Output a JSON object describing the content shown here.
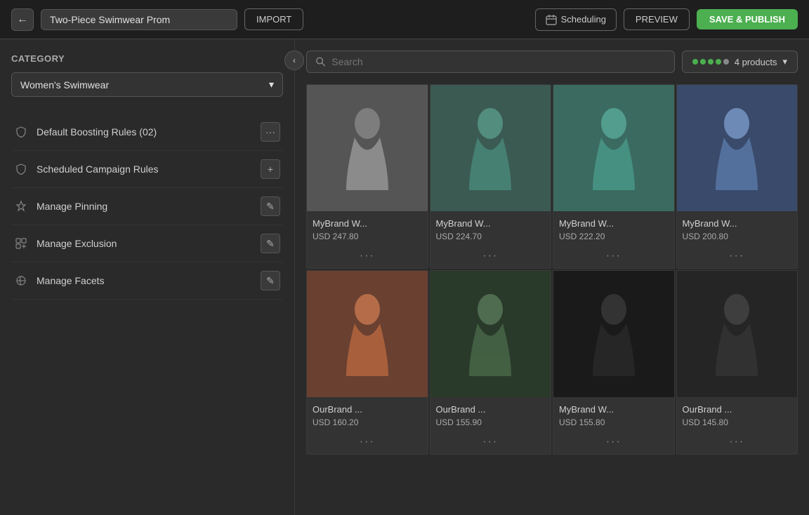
{
  "header": {
    "back_label": "←",
    "page_title": "Two-Piece Swimwear Prom",
    "import_label": "IMPORT",
    "scheduling_label": "Scheduling",
    "preview_label": "PREVIEW",
    "save_publish_label": "SAVE & PUBLISH"
  },
  "sidebar": {
    "category_label": "Category",
    "category_value": "Women's Swimwear",
    "collapse_icon": "‹",
    "menu_items": [
      {
        "id": "boosting",
        "label": "Default Boosting Rules (02)",
        "action": "···",
        "icon_type": "shield"
      },
      {
        "id": "campaign",
        "label": "Scheduled Campaign Rules",
        "action": "+",
        "icon_type": "shield"
      },
      {
        "id": "pinning",
        "label": "Manage Pinning",
        "action": "✎",
        "icon_type": "pin"
      },
      {
        "id": "exclusion",
        "label": "Manage Exclusion",
        "action": "✎",
        "icon_type": "exclude"
      },
      {
        "id": "facets",
        "label": "Manage Facets",
        "action": "✎",
        "icon_type": "facets"
      }
    ]
  },
  "content": {
    "search_placeholder": "Search",
    "filter_label": "4 products",
    "products": [
      {
        "id": 1,
        "name": "MyBrand W...",
        "price": "USD 247.80",
        "color": "#b8b8b8"
      },
      {
        "id": 2,
        "name": "MyBrand W...",
        "price": "USD 224.70",
        "color": "#5a8a7a"
      },
      {
        "id": 3,
        "name": "MyBrand W...",
        "price": "USD 222.20",
        "color": "#4a9a8a"
      },
      {
        "id": 4,
        "name": "MyBrand W...",
        "price": "USD 200.80",
        "color": "#4a6a9a"
      },
      {
        "id": 5,
        "name": "OurBrand ...",
        "price": "USD 160.20",
        "color": "#b87040"
      },
      {
        "id": 6,
        "name": "OurBrand ...",
        "price": "USD 155.90",
        "color": "#3a5a3a"
      },
      {
        "id": 7,
        "name": "MyBrand W...",
        "price": "USD 155.80",
        "color": "#2a2a2a"
      },
      {
        "id": 8,
        "name": "OurBrand ...",
        "price": "USD 145.80",
        "color": "#2a2a2a"
      }
    ]
  }
}
